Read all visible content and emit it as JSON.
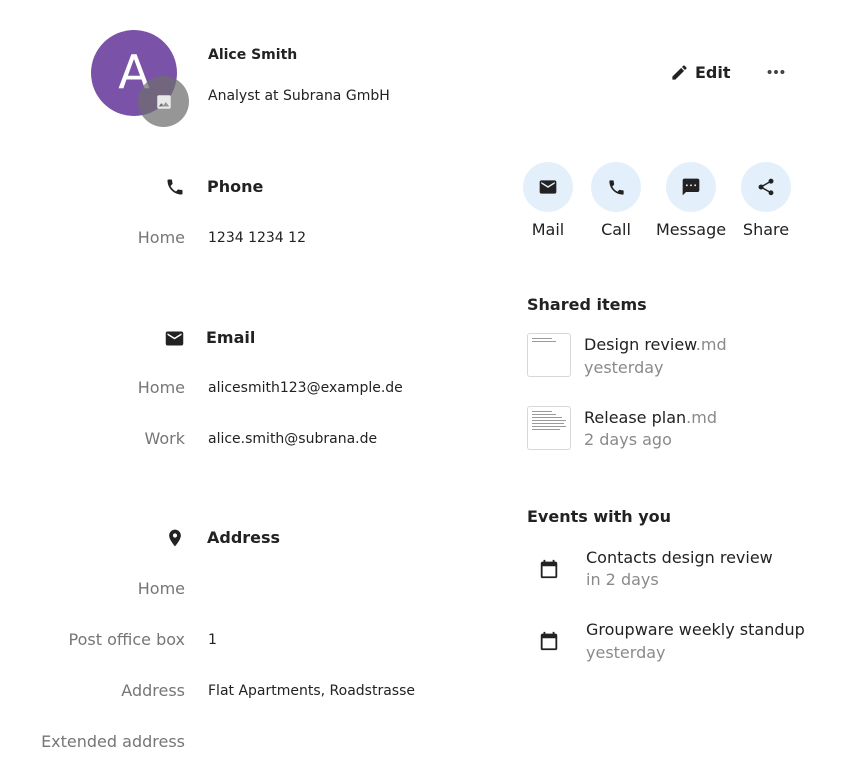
{
  "contact": {
    "initial": "A",
    "name": "Alice Smith",
    "subtitle": "Analyst at Subrana GmbH"
  },
  "header": {
    "edit_label": "Edit"
  },
  "phone": {
    "title": "Phone",
    "entries": [
      {
        "label": "Home",
        "value": "1234 1234 12"
      }
    ]
  },
  "email": {
    "title": "Email",
    "entries": [
      {
        "label": "Home",
        "value": "alicesmith123@example.de"
      },
      {
        "label": "Work",
        "value": "alice.smith@subrana.de"
      }
    ]
  },
  "address": {
    "title": "Address",
    "entries": [
      {
        "label": "Home",
        "value": ""
      },
      {
        "label": "Post office box",
        "value": "1"
      },
      {
        "label": "Address",
        "value": "Flat Apartments, Roadstrasse"
      },
      {
        "label": "Extended address",
        "value": ""
      }
    ]
  },
  "actions": [
    {
      "label": "Mail",
      "icon": "mail-icon"
    },
    {
      "label": "Call",
      "icon": "phone-icon"
    },
    {
      "label": "Message",
      "icon": "message-icon"
    },
    {
      "label": "Share",
      "icon": "share-icon"
    }
  ],
  "shared": {
    "title": "Shared items",
    "items": [
      {
        "name": "Design review",
        "ext": ".md",
        "time": "yesterday"
      },
      {
        "name": "Release plan",
        "ext": ".md",
        "time": "2 days ago"
      }
    ]
  },
  "events": {
    "title": "Events with you",
    "items": [
      {
        "title": "Contacts design review",
        "time": "in 2 days"
      },
      {
        "title": "Groupware weekly standup",
        "time": "yesterday"
      }
    ]
  },
  "colors": {
    "avatar": "#7a52a8",
    "action_bg": "#e3f0fb",
    "label": "#767676",
    "meta": "#8a8a8a"
  }
}
